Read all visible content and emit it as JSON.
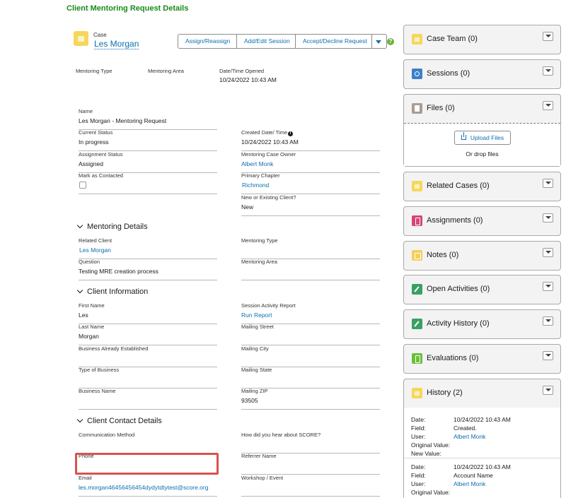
{
  "page_title": "Client Mentoring Request Details",
  "record": {
    "type_label": "Case",
    "name": "Les Morgan",
    "icon": "case-icon"
  },
  "actions": {
    "assign": "Assign/Reassign",
    "add_edit_session": "Add/Edit Session",
    "accept_decline": "Accept/Decline Request",
    "help": "?"
  },
  "highlights": {
    "mentoring_type_label": "Mentoring Type",
    "mentoring_area_label": "Mentoring Area",
    "opened_label": "Date/Time Opened",
    "opened_value": "10/24/2022 10:43 AM"
  },
  "fields": {
    "name": {
      "label": "Name",
      "value": "Les Morgan - Mentoring Request"
    },
    "current_status": {
      "label": "Current Status",
      "value": "In progress"
    },
    "created_date": {
      "label": "Created Date/ Time",
      "value": "10/24/2022 10:43 AM"
    },
    "assignment_status": {
      "label": "Assignment Status",
      "value": "Assigned"
    },
    "case_owner": {
      "label": "Mentoring Case Owner",
      "value": "Albert Monk"
    },
    "mark_contacted": {
      "label": "Mark as Contacted"
    },
    "primary_chapter": {
      "label": "Primary Chapter",
      "value": "Richmond"
    },
    "new_existing": {
      "label": "New or Existing Client?",
      "value": "New"
    }
  },
  "sections": {
    "mentoring_details": "Mentoring Details",
    "client_information": "Client Information",
    "client_contact": "Client Contact Details"
  },
  "mentoring": {
    "related_client": {
      "label": "Related Client",
      "value": "Les Morgan"
    },
    "mentoring_type": {
      "label": "Mentoring Type",
      "value": ""
    },
    "question": {
      "label": "Question",
      "value": "Testing MRE creation process"
    },
    "mentoring_area": {
      "label": "Mentoring Area",
      "value": ""
    }
  },
  "client_info": {
    "first_name": {
      "label": "First Name",
      "value": "Les"
    },
    "session_report": {
      "label": "Session Activity Report",
      "value": "Run Report"
    },
    "last_name": {
      "label": "Last Name",
      "value": "Morgan"
    },
    "mailing_street": {
      "label": "Mailing Street",
      "value": ""
    },
    "business_established": {
      "label": "Business Already Established",
      "value": ""
    },
    "mailing_city": {
      "label": "Mailing City",
      "value": ""
    },
    "type_business": {
      "label": "Type of Business",
      "value": ""
    },
    "mailing_state": {
      "label": "Mailing State",
      "value": ""
    },
    "business_name": {
      "label": "Business Name",
      "value": ""
    },
    "mailing_zip": {
      "label": "Mailing ZIP",
      "value": "93505"
    }
  },
  "contact": {
    "communication_method": {
      "label": "Communication Method",
      "value": ""
    },
    "heard_about": {
      "label": "How did you hear about SCORE?",
      "value": ""
    },
    "phone": {
      "label": "Phone",
      "value": ""
    },
    "referrer": {
      "label": "Referrer Name",
      "value": ""
    },
    "email": {
      "label": "Email",
      "value": "les.morgan46456456454dydytdtytest@score.org"
    },
    "workshop": {
      "label": "Workshop / Event",
      "value": ""
    }
  },
  "sidebar": {
    "case_team": "Case Team (0)",
    "sessions": "Sessions (0)",
    "files": "Files (0)",
    "upload_files": "Upload Files",
    "drop_files": "Or drop files",
    "related_cases": "Related Cases (0)",
    "assignments": "Assignments (0)",
    "notes": "Notes (0)",
    "open_activities": "Open Activities (0)",
    "activity_history": "Activity History (0)",
    "evaluations": "Evaluations (0)",
    "history": "History (2)"
  },
  "history": {
    "date_label": "Date:",
    "field_label": "Field:",
    "user_label": "User:",
    "original_label": "Original Value:",
    "new_label": "New Value:",
    "entries": [
      {
        "date": "10/24/2022 10:43 AM",
        "field": "Created.",
        "user": "Albert Monk"
      },
      {
        "date": "10/24/2022 10:43 AM",
        "field": "Account Name",
        "user": "Albert Monk"
      }
    ]
  }
}
